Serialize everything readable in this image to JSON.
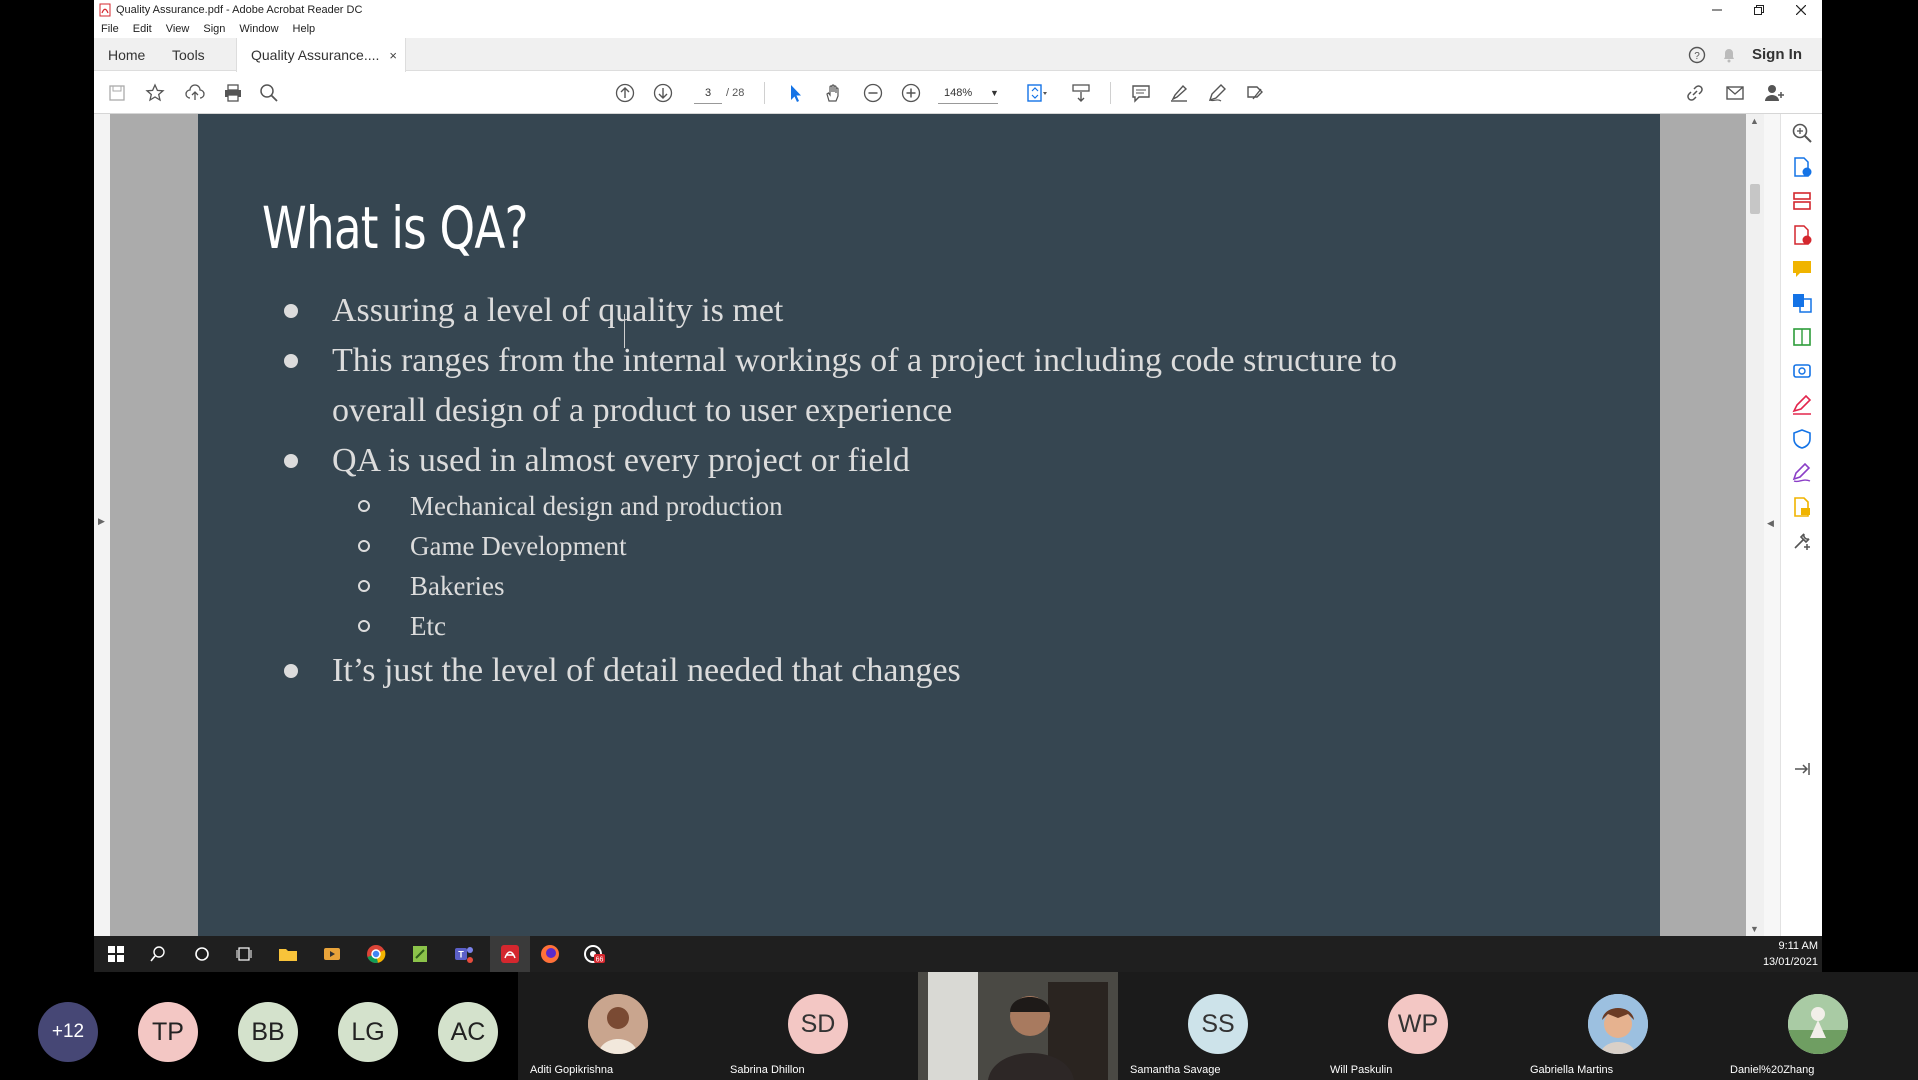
{
  "window": {
    "title": "Quality Assurance.pdf - Adobe Acrobat Reader DC",
    "controls": [
      "minimize",
      "restore",
      "close"
    ]
  },
  "menu": [
    "File",
    "Edit",
    "View",
    "Sign",
    "Window",
    "Help"
  ],
  "tabs": {
    "home": "Home",
    "tools": "Tools",
    "document": "Quality Assurance....",
    "close": "×",
    "sign_in": "Sign In"
  },
  "toolbar": {
    "page_current": "3",
    "page_total": "/ 28",
    "zoom": "148%"
  },
  "slide": {
    "title": "What is QA?",
    "bullets": [
      "Assuring a level of quality is met",
      "This ranges from the internal workings of a project including code structure to",
      "overall design of a product to user experience",
      "QA is used in almost every project or field",
      "It’s just the level of detail needed that changes"
    ],
    "sub_bullets": [
      "Mechanical design and production",
      "Game Development",
      "Bakeries",
      "Etc"
    ]
  },
  "taskbar": {
    "time": "9:11 AM",
    "date": "13/01/2021",
    "badge": "66"
  },
  "participants": {
    "overflow": "+12",
    "initials": [
      "TP",
      "BB",
      "LG",
      "AC"
    ],
    "tiles": [
      {
        "name": "Aditi Gopikrishna",
        "initials": ""
      },
      {
        "name": "Sabrina Dhillon",
        "initials": "SD"
      },
      {
        "name": "",
        "initials": ""
      },
      {
        "name": "Samantha Savage",
        "initials": "SS"
      },
      {
        "name": "Will Paskulin",
        "initials": "WP"
      },
      {
        "name": "Gabriella Martins",
        "initials": ""
      },
      {
        "name": "Daniel%20Zhang",
        "initials": ""
      }
    ]
  },
  "colors": {
    "slide_bg": "#364651",
    "slide_text": "#dcdcdc",
    "acrobat_red": "#d4272e",
    "teams_purple": "#464775"
  }
}
